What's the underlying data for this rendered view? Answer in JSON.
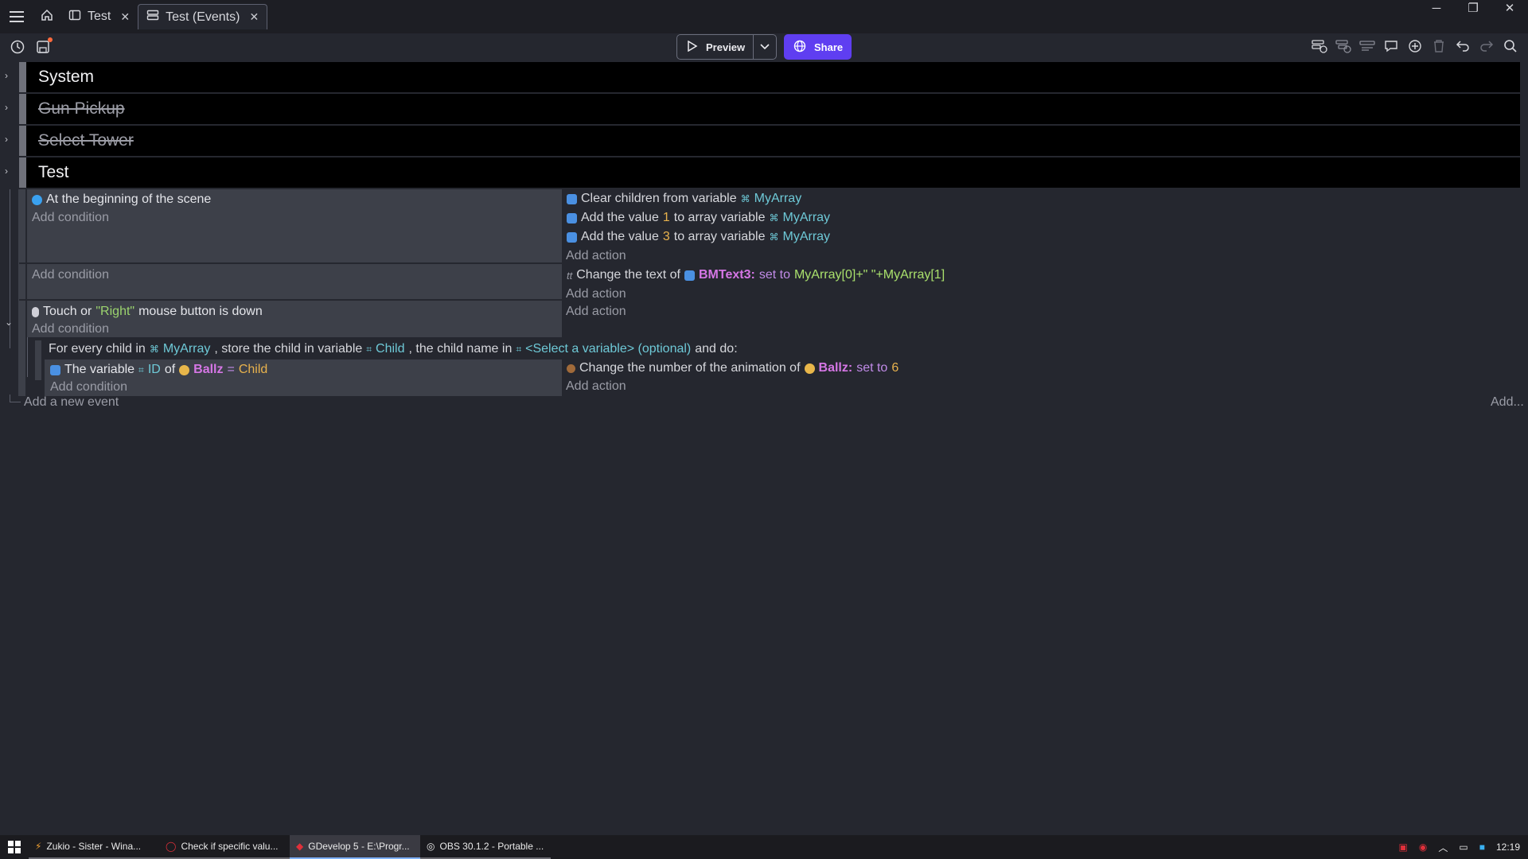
{
  "tabs": [
    {
      "label": "Test",
      "closable": true
    },
    {
      "label": "Test (Events)",
      "closable": true,
      "active": true
    }
  ],
  "toolbar": {
    "preview_label": "Preview",
    "share_label": "Share"
  },
  "groups": [
    {
      "name": "System",
      "disabled": false
    },
    {
      "name": "Gun Pickup",
      "disabled": true
    },
    {
      "name": "Select Tower",
      "disabled": true
    },
    {
      "name": "Test",
      "disabled": false
    }
  ],
  "event1": {
    "cond": "At the beginning of the scene",
    "add_condition": "Add condition",
    "a1_text": "Clear children from variable",
    "a1_var": "MyArray",
    "a2_pre": "Add the value",
    "a2_num": "1",
    "a2_mid": "to array variable",
    "a2_var": "MyArray",
    "a3_pre": "Add the value",
    "a3_num": "3",
    "a3_mid": "to array variable",
    "a3_var": "MyArray",
    "add_action": "Add action"
  },
  "event2": {
    "add_condition": "Add condition",
    "a_pre": "Change the text of",
    "a_obj": "BMText3",
    "a_sep": ":",
    "a_kw": "set to",
    "a_expr": "MyArray[0]+\" \"+MyArray[1]",
    "add_action": "Add action"
  },
  "event3": {
    "cond_pre": "Touch or",
    "cond_str": "\"Right\"",
    "cond_post": "mouse button is down",
    "add_condition": "Add condition",
    "add_action": "Add action"
  },
  "foreach": {
    "t1": "For every child in",
    "var1": "MyArray",
    "t2": ", store the child in variable",
    "var2": "Child",
    "t3": ", the child name in",
    "var3": "<Select a variable> (optional)",
    "t4": "and do:",
    "c_pre": "The variable",
    "c_var": "ID",
    "c_of": "of",
    "c_obj": "Ballz",
    "c_op": "=",
    "c_val": "Child",
    "add_condition": "Add condition",
    "a_pre": "Change the number of the animation of",
    "a_obj": "Ballz",
    "a_sep": ":",
    "a_kw": "set to",
    "a_num": "6",
    "add_action": "Add action"
  },
  "footer": {
    "add_event": "Add a new event",
    "add_more": "Add..."
  },
  "taskbar": {
    "items": [
      "Zukio - Sister - Wina...",
      "Check if specific valu...",
      "GDevelop 5 - E:\\Progr...",
      "OBS 30.1.2 - Portable ..."
    ],
    "time": "12:19"
  }
}
